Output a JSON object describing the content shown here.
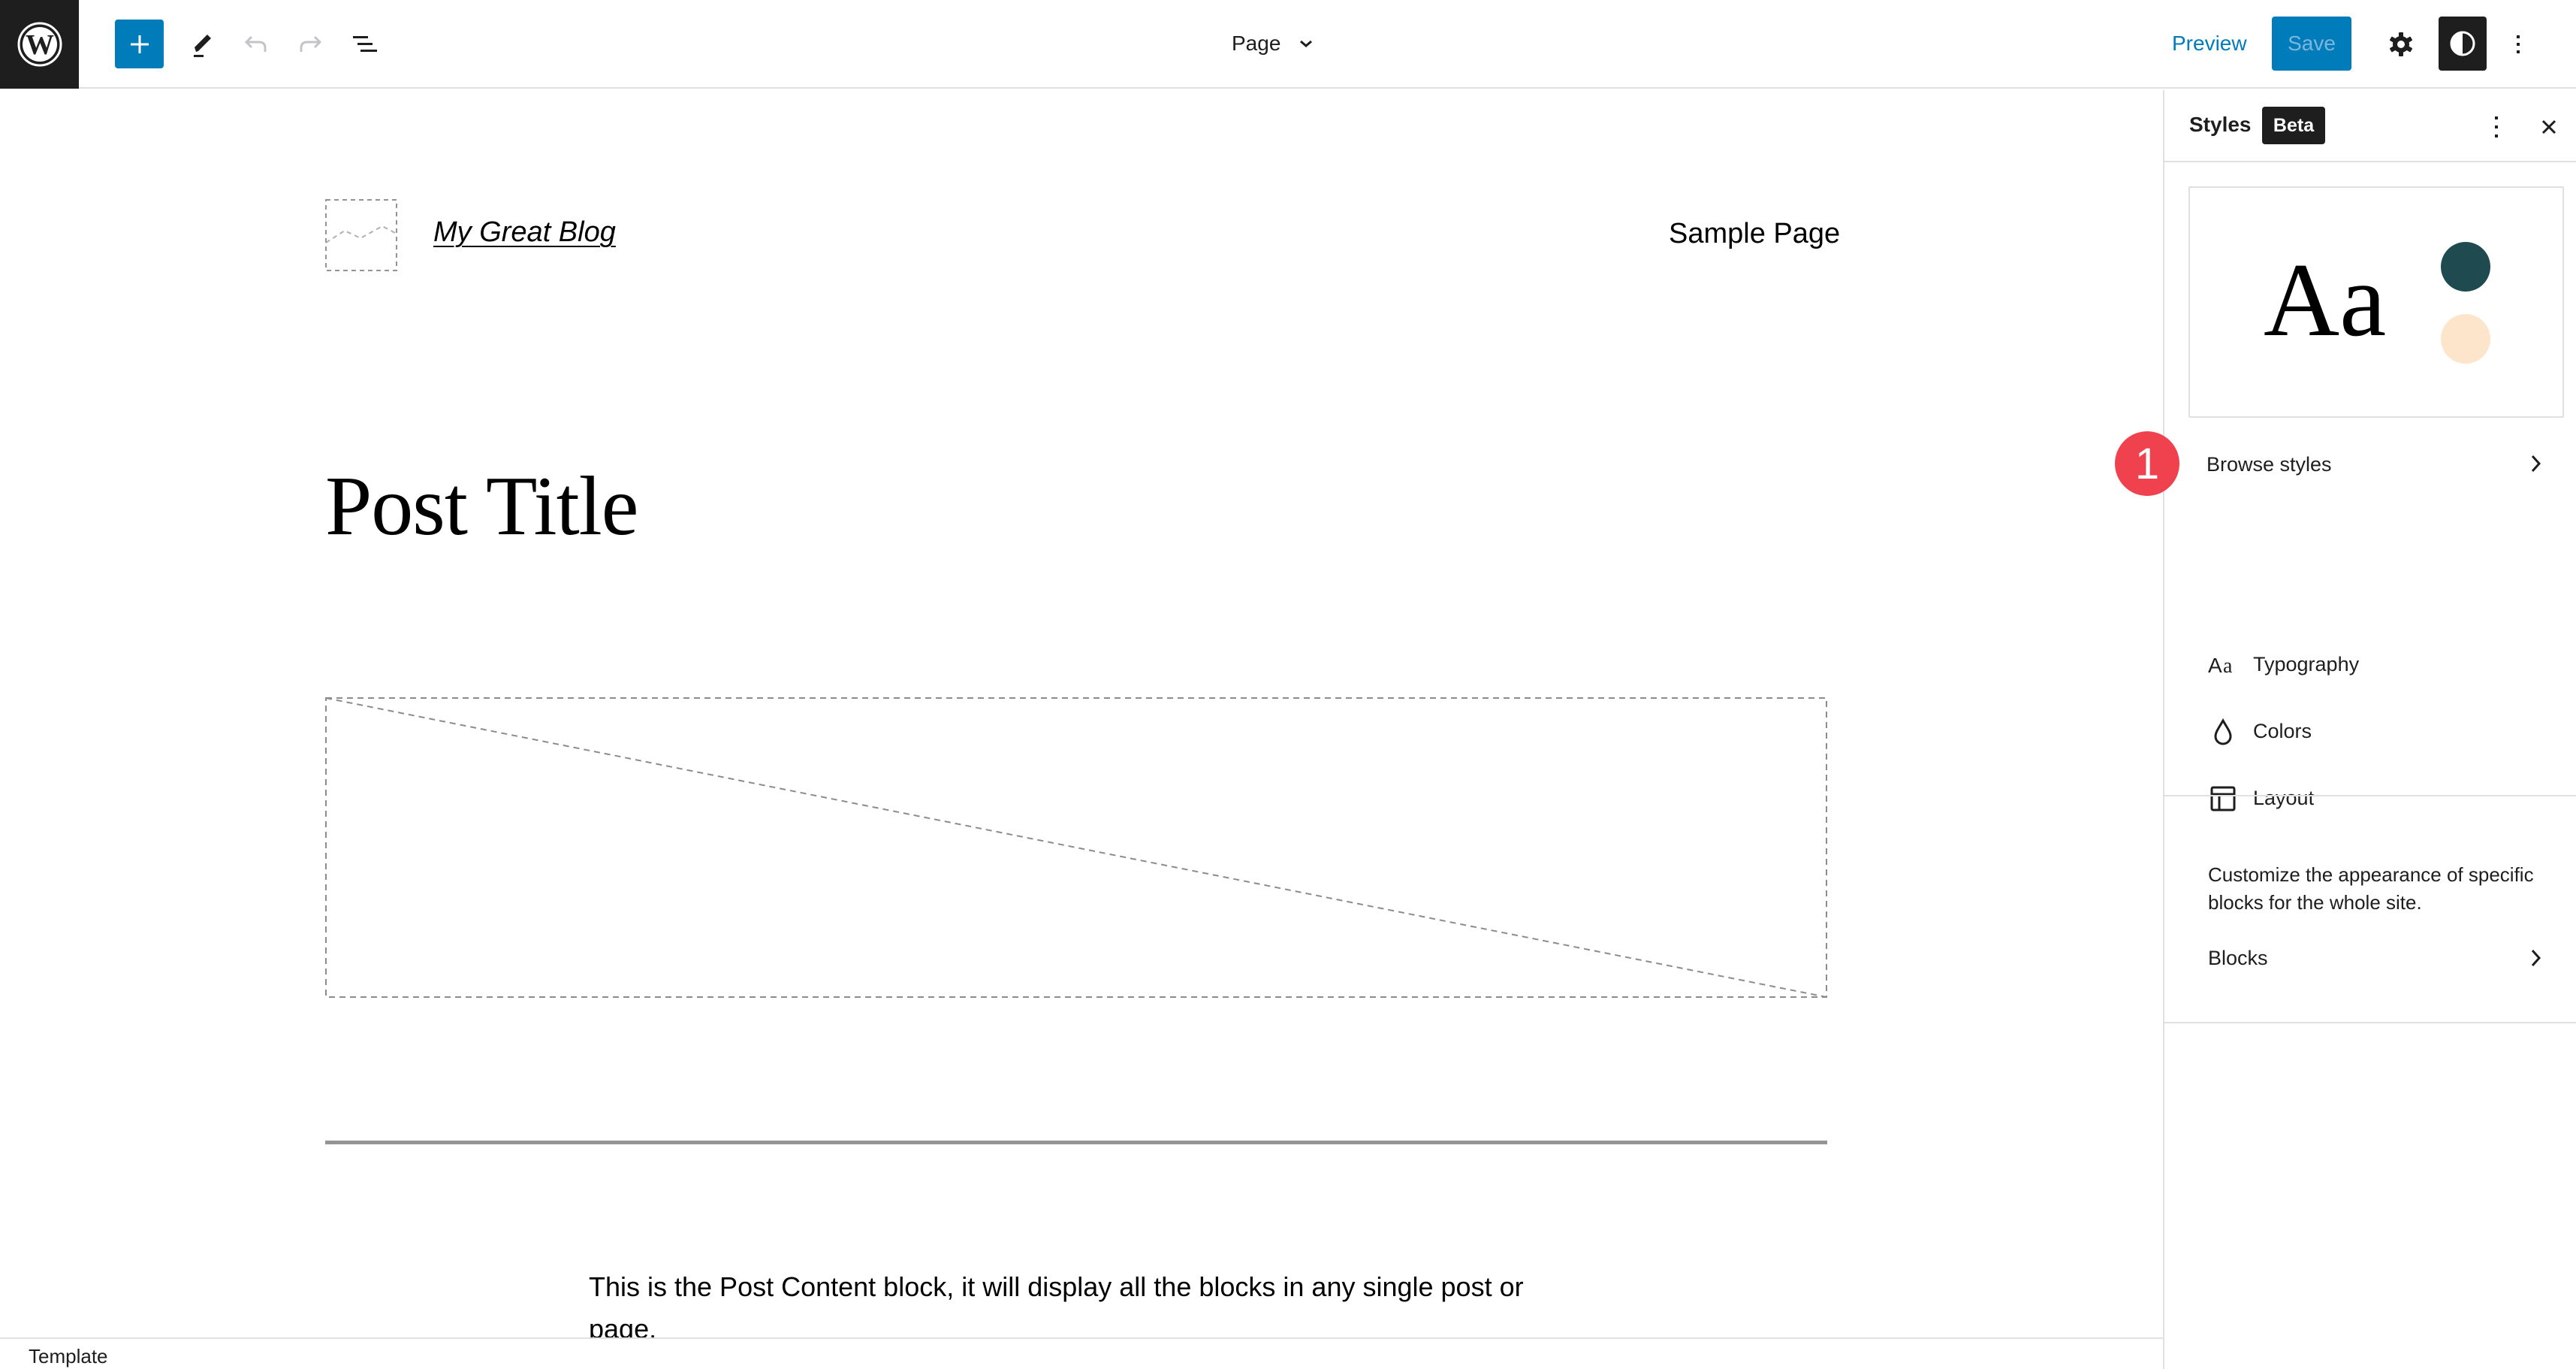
{
  "header": {
    "logo_icon": "wordpress-logo-icon",
    "inserter_icon": "plus-icon",
    "tools_icon": "pencil-icon",
    "undo_icon": "undo-icon",
    "redo_icon": "redo-icon",
    "list_view_icon": "list-view-icon",
    "document_title": "Page",
    "preview_label": "Preview",
    "save_label": "Save",
    "settings_icon": "gear-icon",
    "styles_icon": "half-circle-contrast-icon",
    "options_icon": "kebab-menu-icon"
  },
  "canvas": {
    "site_title": "My Great Blog",
    "nav_item": "Sample Page",
    "post_title": "Post Title",
    "post_content": "This is the Post Content block, it will display all the blocks in any single post or page."
  },
  "footer": {
    "breadcrumb": "Template"
  },
  "sidebar": {
    "title": "Styles",
    "badge": "Beta",
    "preview": {
      "sample_text": "Aa",
      "swatches": [
        "#1f4a4f",
        "#fde5cb"
      ]
    },
    "browse_styles_label": "Browse styles",
    "step_badge": "1",
    "nav_items": [
      {
        "label": "Typography",
        "icon": "typography-icon"
      },
      {
        "label": "Colors",
        "icon": "droplet-icon"
      },
      {
        "label": "Layout",
        "icon": "layout-icon"
      }
    ],
    "blocks_description": "Customize the appearance of specific blocks for the whole site.",
    "blocks_label": "Blocks"
  },
  "colors": {
    "accent": "#007cba",
    "dark": "#1e1e1e",
    "badge_red": "#f0414f"
  }
}
